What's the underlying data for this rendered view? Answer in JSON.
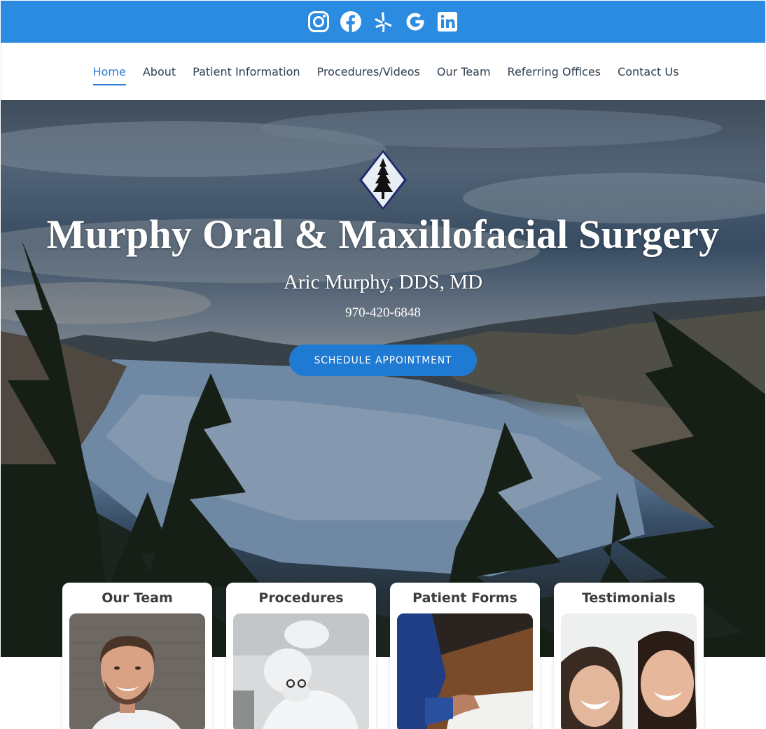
{
  "social": {
    "icons": [
      "instagram-icon",
      "facebook-icon",
      "yelp-icon",
      "google-icon",
      "linkedin-icon"
    ],
    "background": "#2b8be0"
  },
  "nav": {
    "items": [
      {
        "label": "Home",
        "active": true
      },
      {
        "label": "About"
      },
      {
        "label": "Patient Information"
      },
      {
        "label": "Procedures/Videos"
      },
      {
        "label": "Our Team"
      },
      {
        "label": "Referring Offices"
      },
      {
        "label": "Contact Us"
      }
    ],
    "accent": "#2b7ed6"
  },
  "hero": {
    "logo_icon": "pine-tree-diamond-logo",
    "title": "Murphy Oral & Maxillofacial Surgery",
    "doctor": "Aric Murphy, DDS, MD",
    "phone": "970-420-6848",
    "cta_label": "SCHEDULE APPOINTMENT",
    "cta_color": "#1e7ad3"
  },
  "cards": [
    {
      "title": "Our Team",
      "photo": "smiling-doctor-portrait"
    },
    {
      "title": "Procedures",
      "photo": "surgeon-in-operating-room"
    },
    {
      "title": "Patient Forms",
      "photo": "signing-paperwork"
    },
    {
      "title": "Testimonials",
      "photo": "two-smiling-women"
    }
  ]
}
